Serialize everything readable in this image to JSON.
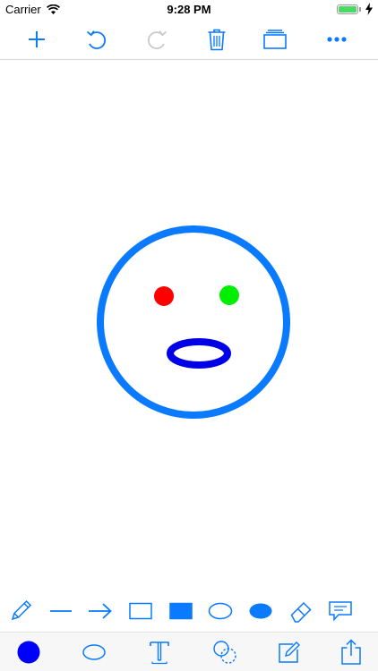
{
  "status_bar": {
    "carrier": "Carrier",
    "time": "9:28 PM",
    "battery_color": "#4cd964"
  },
  "colors": {
    "accent": "#0a7aff",
    "face_outline": "#0a7aff",
    "left_eye": "#ff0000",
    "right_eye": "#00ee00",
    "mouth": "#0000e6",
    "current_color": "#0000ff"
  },
  "top_toolbar": [
    {
      "icon": "plus-icon",
      "enabled": true
    },
    {
      "icon": "undo-icon",
      "enabled": true
    },
    {
      "icon": "redo-icon",
      "enabled": false
    },
    {
      "icon": "trash-icon",
      "enabled": true
    },
    {
      "icon": "layers-icon",
      "enabled": true
    },
    {
      "icon": "more-icon",
      "enabled": true
    }
  ],
  "shape_tools": [
    "pencil-icon",
    "line-icon",
    "arrow-icon",
    "rectangle-icon",
    "filled-rectangle-icon",
    "ellipse-icon",
    "filled-ellipse-icon",
    "eraser-icon",
    "speech-bubble-icon"
  ],
  "bottom_tools": [
    "color-swatch-icon",
    "stroke-shape-icon",
    "text-icon",
    "select-shapes-icon",
    "edit-icon",
    "share-icon"
  ]
}
